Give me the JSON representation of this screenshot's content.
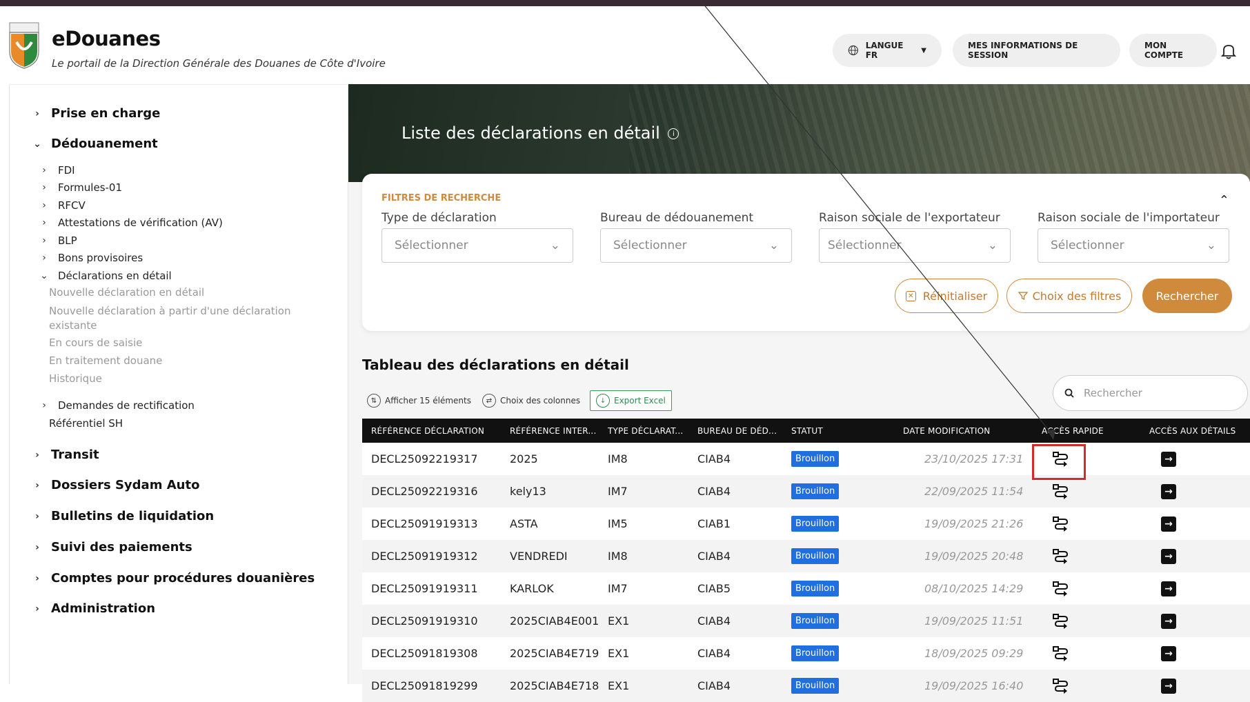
{
  "header": {
    "brand": "eDouanes",
    "tagline": "Le portail de la Direction Générale des Douanes de Côte d'Ivoire",
    "language_label": "LANGUE FR",
    "session_label": "MES INFORMATIONS DE SESSION",
    "account_label": "MON COMPTE"
  },
  "sidebar": {
    "prise_en_charge": "Prise en charge",
    "dedouanement": "Dédouanement",
    "fdi": "FDI",
    "formules": "Formules-01",
    "rfcv": "RFCV",
    "av": "Attestations de vérification (AV)",
    "blp": "BLP",
    "bons": "Bons provisoires",
    "declarations": "Déclarations en détail",
    "leaf_nouvelle": "Nouvelle déclaration en détail",
    "leaf_nouvelle_partir": "Nouvelle déclaration à partir d'une déclaration existante",
    "leaf_en_cours": "En cours de saisie",
    "leaf_traitement": "En traitement douane",
    "leaf_historique": "Historique",
    "rectification": "Demandes de rectification",
    "referentiel": "Référentiel SH",
    "transit": "Transit",
    "sydam": "Dossiers Sydam Auto",
    "bulletins": "Bulletins de liquidation",
    "paiements": "Suivi des paiements",
    "comptes": "Comptes pour procédures douanières",
    "administration": "Administration"
  },
  "main": {
    "page_title": "Liste des déclarations en détail",
    "filters": {
      "title": "FILTRES DE RECHERCHE",
      "type_label": "Type de déclaration",
      "bureau_label": "Bureau de dédouanement",
      "exportateur_label": "Raison sociale de l'exportateur",
      "importateur_label": "Raison sociale de l'importateur",
      "select_placeholder": "Sélectionner",
      "reset_label": "Réinitialiser",
      "choice_label": "Choix des filtres",
      "search_label": "Rechercher"
    },
    "table": {
      "title": "Tableau des déclarations en détail",
      "show_label": "Afficher 15 éléments",
      "columns_label": "Choix des colonnes",
      "export_label": "Export Excel",
      "search_placeholder": "Rechercher",
      "headers": [
        "RÉFÉRENCE DÉCLARATION",
        "RÉFÉRENCE INTER...",
        "TYPE DÉCLARAT...",
        "BUREAU DE DÉD...",
        "STATUT",
        "DATE MODIFICATION",
        "ACCÈS RAPIDE",
        "ACCÈS AUX DÉTAILS"
      ],
      "rows": [
        {
          "ref": "DECL25092219317",
          "inter": "2025",
          "type": "IM8",
          "bureau": "CIAB4",
          "statut": "Brouillon",
          "date": "23/10/2025 17:31"
        },
        {
          "ref": "DECL25092219316",
          "inter": "kely13",
          "type": "IM7",
          "bureau": "CIAB4",
          "statut": "Brouillon",
          "date": "22/09/2025 11:54"
        },
        {
          "ref": "DECL25091919313",
          "inter": "ASTA",
          "type": "IM5",
          "bureau": "CIAB1",
          "statut": "Brouillon",
          "date": "19/09/2025 21:26"
        },
        {
          "ref": "DECL25091919312",
          "inter": "VENDREDI",
          "type": "IM8",
          "bureau": "CIAB4",
          "statut": "Brouillon",
          "date": "19/09/2025 20:48"
        },
        {
          "ref": "DECL25091919311",
          "inter": "KARLOK",
          "type": "IM7",
          "bureau": "CIAB5",
          "statut": "Brouillon",
          "date": "08/10/2025 14:29"
        },
        {
          "ref": "DECL25091919310",
          "inter": "2025CIAB4E001",
          "type": "EX1",
          "bureau": "CIAB4",
          "statut": "Brouillon",
          "date": "19/09/2025 11:51"
        },
        {
          "ref": "DECL25091819308",
          "inter": "2025CIAB4E719",
          "type": "EX1",
          "bureau": "CIAB4",
          "statut": "Brouillon",
          "date": "18/09/2025 09:29"
        },
        {
          "ref": "DECL25091819299",
          "inter": "2025CIAB4E718",
          "type": "EX1",
          "bureau": "CIAB4",
          "statut": "Brouillon",
          "date": "19/09/2025 16:40"
        }
      ]
    }
  },
  "colors": {
    "accent": "#d08a3c",
    "badge": "#1f6fe0",
    "highlight": "#d32b2b"
  }
}
